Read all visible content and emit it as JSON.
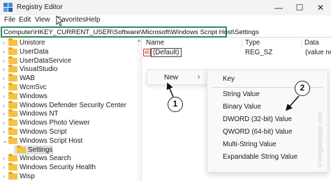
{
  "window": {
    "title": "Registry Editor",
    "controls": {
      "minimize": "—",
      "maximize": "☐",
      "close": "✕"
    }
  },
  "menu": [
    "File",
    "Edit",
    "View",
    "Favorites",
    "Help"
  ],
  "address": "Computer\\HKEY_CURRENT_USER\\Software\\Microsoft\\Windows Script Host\\Settings",
  "tree": [
    {
      "label": "Unistore",
      "expandable": true,
      "depth": 0
    },
    {
      "label": "UserData",
      "expandable": true,
      "depth": 0
    },
    {
      "label": "UserDataService",
      "expandable": true,
      "depth": 0
    },
    {
      "label": "VisualStudio",
      "expandable": true,
      "depth": 0
    },
    {
      "label": "WAB",
      "expandable": true,
      "depth": 0
    },
    {
      "label": "WcmSvc",
      "expandable": true,
      "depth": 0
    },
    {
      "label": "Windows",
      "expandable": true,
      "depth": 0
    },
    {
      "label": "Windows Defender Security Center",
      "expandable": true,
      "depth": 0
    },
    {
      "label": "Windows NT",
      "expandable": true,
      "depth": 0
    },
    {
      "label": "Windows Photo Viewer",
      "expandable": true,
      "depth": 0
    },
    {
      "label": "Windows Script",
      "expandable": true,
      "depth": 0
    },
    {
      "label": "Windows Script Host",
      "expandable": true,
      "expanded": true,
      "depth": 0
    },
    {
      "label": "Settings",
      "expandable": false,
      "depth": 1,
      "selected": true
    },
    {
      "label": "Windows Search",
      "expandable": true,
      "depth": 0
    },
    {
      "label": "Windows Security Health",
      "expandable": true,
      "depth": 0
    },
    {
      "label": "Wisp",
      "expandable": true,
      "depth": 0
    }
  ],
  "columns": {
    "name": "Name",
    "type": "Type",
    "data": "Data"
  },
  "values": [
    {
      "icon": "ab",
      "name": "(Default)",
      "type": "REG_SZ",
      "data": "(value no"
    }
  ],
  "context_menu": {
    "new_label": "New",
    "arrow": "›"
  },
  "submenu": {
    "key": "Key",
    "items": [
      "String Value",
      "Binary Value",
      "DWORD (32-bit) Value",
      "QWORD (64-bit) Value",
      "Multi-String Value",
      "Expandable String Value"
    ]
  },
  "annotations": [
    "1",
    "2"
  ],
  "watermark": "©thegeekpage.com"
}
